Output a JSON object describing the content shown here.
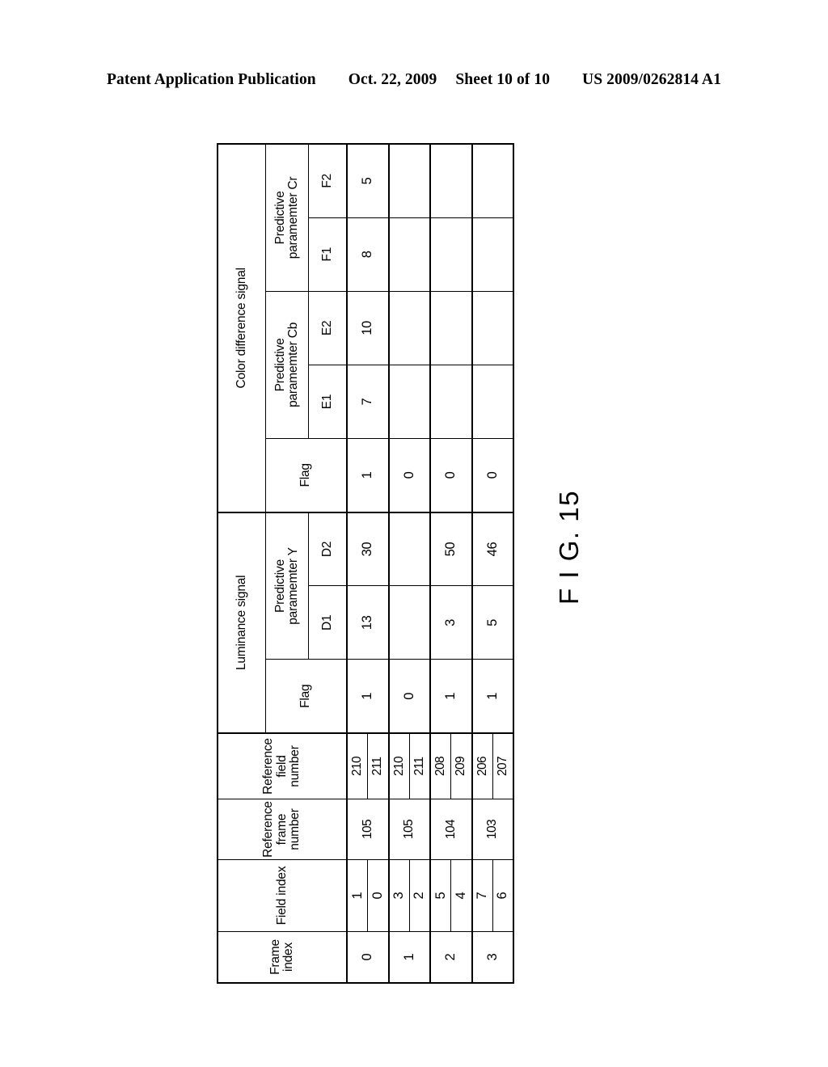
{
  "page_header": {
    "publication": "Patent Application Publication",
    "date": "Oct. 22, 2009",
    "sheet": "Sheet 10 of 10",
    "patent_number": "US 2009/0262814 A1"
  },
  "figure": {
    "label": "F I G. 15"
  },
  "table": {
    "group_headers": {
      "frame_index": "Frame index",
      "field_index": "Field index",
      "reference_frame_number_line1": "Reference",
      "reference_frame_number_line2": "frame number",
      "reference_field_number_line1": "Reference",
      "reference_field_number_line2": "field number",
      "luminance_signal": "Luminance signal",
      "color_difference_signal": "Color difference  signal"
    },
    "sub_headers": {
      "luminance_flag": "Flag",
      "predictive_parameter_y_line1": "Predictive",
      "predictive_parameter_y_line2": "paramemter Y",
      "d1": "D1",
      "d2": "D2",
      "color_flag": "Flag",
      "predictive_parameter_cb_line1": "Predictive",
      "predictive_parameter_cb_line2": "paramemter Cb",
      "e1": "E1",
      "e2": "E2",
      "predictive_parameter_cr_line1": "Predictive",
      "predictive_parameter_cr_line2": "paramemter Cr",
      "f1": "F1",
      "f2": "F2"
    },
    "rows": [
      {
        "frame_index": "0",
        "reference_frame_number": "105",
        "fields": [
          {
            "field_index": "1",
            "reference_field_number": "210"
          },
          {
            "field_index": "0",
            "reference_field_number": "211"
          }
        ],
        "luminance_flag": "1",
        "d1": "13",
        "d2": "30",
        "color_flag": "1",
        "e1": "7",
        "e2": "10",
        "f1": "8",
        "f2": "5"
      },
      {
        "frame_index": "1",
        "reference_frame_number": "105",
        "fields": [
          {
            "field_index": "3",
            "reference_field_number": "210"
          },
          {
            "field_index": "2",
            "reference_field_number": "211"
          }
        ],
        "luminance_flag": "0",
        "d1": "",
        "d2": "",
        "color_flag": "0",
        "e1": "",
        "e2": "",
        "f1": "",
        "f2": ""
      },
      {
        "frame_index": "2",
        "reference_frame_number": "104",
        "fields": [
          {
            "field_index": "5",
            "reference_field_number": "208"
          },
          {
            "field_index": "4",
            "reference_field_number": "209"
          }
        ],
        "luminance_flag": "1",
        "d1": "3",
        "d2": "50",
        "color_flag": "0",
        "e1": "",
        "e2": "",
        "f1": "",
        "f2": ""
      },
      {
        "frame_index": "3",
        "reference_frame_number": "103",
        "fields": [
          {
            "field_index": "7",
            "reference_field_number": "206"
          },
          {
            "field_index": "6",
            "reference_field_number": "207"
          }
        ],
        "luminance_flag": "1",
        "d1": "5",
        "d2": "46",
        "color_flag": "0",
        "e1": "",
        "e2": "",
        "f1": "",
        "f2": ""
      }
    ]
  }
}
